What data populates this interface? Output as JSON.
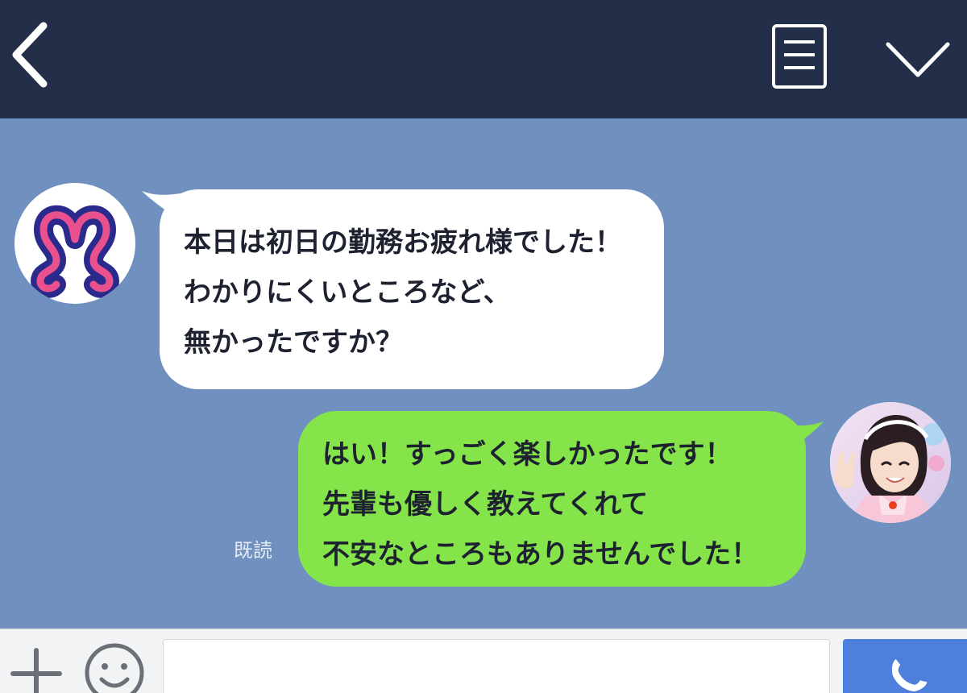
{
  "header": {
    "back_icon": "chevron-left-icon",
    "notes_icon": "notes-icon",
    "menu_icon": "chevron-down-icon",
    "background": "#232e48"
  },
  "chat": {
    "background": "#7090c0",
    "incoming": {
      "lines": [
        "本日は初日の勤務お疲れ様でした！",
        "わかりにくいところなど、",
        "無かったですか？"
      ],
      "avatar_icon": "brand-logo-icon",
      "bubble_color": "#ffffff"
    },
    "outgoing": {
      "lines": [
        "はい！すっごく楽しかったです！",
        "先輩も優しく教えてくれて",
        "不安なところもありませんでした！"
      ],
      "read_label": "既読",
      "avatar_icon": "user-avatar-icon",
      "bubble_color": "#84e44a"
    }
  },
  "input_bar": {
    "plus_icon": "plus-icon",
    "emoji_icon": "smiley-icon",
    "input_value": "",
    "call_icon": "phone-icon",
    "call_color": "#4f7fdc"
  }
}
